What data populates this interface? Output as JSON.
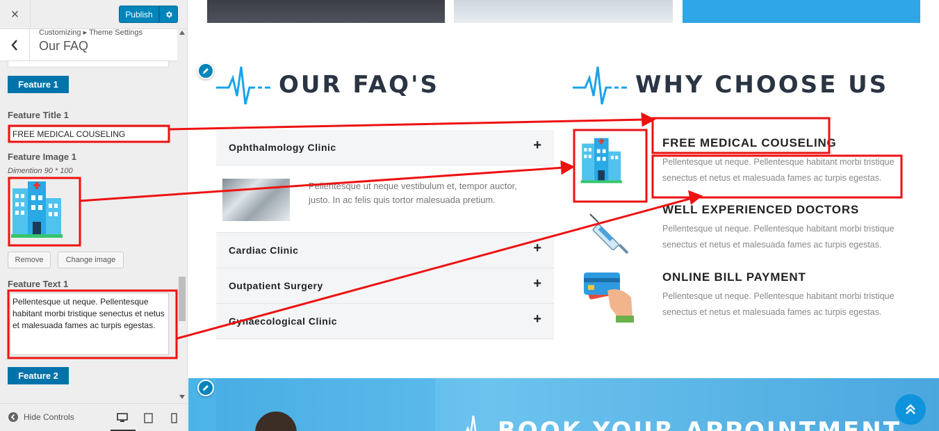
{
  "customizer": {
    "close_label": "×",
    "publish_label": "Publish",
    "breadcrumb": "Customizing ▸ Theme Settings",
    "section_title": "Our FAQ",
    "feature1_heading": "Feature 1",
    "feature_title_label": "Feature Title 1",
    "feature_title_value": "FREE MEDICAL COUSELING",
    "feature_image_label": "Feature Image 1",
    "feature_image_desc": "Dimention 90 * 100",
    "remove_label": "Remove",
    "change_image_label": "Change image",
    "feature_text_label": "Feature Text 1",
    "feature_text_value": "Pellentesque ut neque. Pellentesque habitant morbi tristique senectus et netus et malesuada fames ac turpis egestas.",
    "feature2_heading": "Feature 2",
    "hide_controls_label": "Hide Controls"
  },
  "preview": {
    "faq_heading": "OUR FAQ'S",
    "why_heading": "WHY CHOOSE US",
    "faqs": [
      {
        "question": "Ophthalmology Clinic",
        "expanded": true,
        "answer": "Pellentesque ut neque vestibulum et, tempor auctor, justo. In ac felis quis tortor malesuada pretium."
      },
      {
        "question": "Cardiac Clinic",
        "expanded": false
      },
      {
        "question": "Outpatient Surgery",
        "expanded": false
      },
      {
        "question": "Gynaecological Clinic",
        "expanded": false
      }
    ],
    "features": [
      {
        "title": "FREE MEDICAL COUSELING",
        "text": "Pellentesque ut neque. Pellentesque habitant morbi tristique senectus et netus et malesuada fames ac turpis egestas.",
        "icon": "hospital-icon"
      },
      {
        "title": "WELL EXPERIENCED DOCTORS",
        "text": "Pellentesque ut neque. Pellentesque habitant morbi tristique senectus et netus et malesuada fames ac turpis egestas.",
        "icon": "syringe-icon"
      },
      {
        "title": "ONLINE BILL PAYMENT",
        "text": "Pellentesque ut neque. Pellentesque habitant morbi tristique senectus et netus et malesuada fames ac turpis egestas.",
        "icon": "credit-card-icon"
      }
    ],
    "appointment_heading": "BOOK YOUR APPOINTMENT"
  },
  "colors": {
    "wp_blue": "#0073aa",
    "publish_blue": "#0085ba",
    "heading_dark": "#2a3443",
    "accent_blue": "#1aa3e8",
    "annotation_red": "#ee1111"
  }
}
